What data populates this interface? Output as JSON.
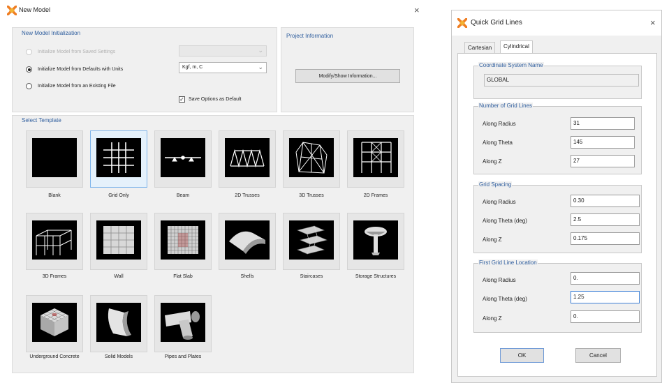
{
  "new_model": {
    "title": "New Model",
    "close_glyph": "×",
    "initialization": {
      "title": "New Model Initialization",
      "option_saved": "Initialize Model from Saved Settings",
      "option_defaults": "Initialize Model from Defaults with Units",
      "option_existing": "Initialize Model from an Existing File",
      "units_value": "Kgf, m, C",
      "save_default_label": "Save Options as Default",
      "save_default_check": "✓"
    },
    "project_information": {
      "title": "Project Information",
      "button_label": "Modify/Show Information..."
    },
    "templates": {
      "title": "Select Template",
      "items": [
        {
          "label": "Blank",
          "icon": "blank-template-icon"
        },
        {
          "label": "Grid Only",
          "icon": "grid-only-template-icon"
        },
        {
          "label": "Beam",
          "icon": "beam-template-icon"
        },
        {
          "label": "2D Trusses",
          "icon": "2d-trusses-template-icon"
        },
        {
          "label": "3D Trusses",
          "icon": "3d-trusses-template-icon"
        },
        {
          "label": "2D Frames",
          "icon": "2d-frames-template-icon"
        },
        {
          "label": "3D Frames",
          "icon": "3d-frames-template-icon"
        },
        {
          "label": "Wall",
          "icon": "wall-template-icon"
        },
        {
          "label": "Flat Slab",
          "icon": "flat-slab-template-icon"
        },
        {
          "label": "Shells",
          "icon": "shells-template-icon"
        },
        {
          "label": "Staircases",
          "icon": "staircases-template-icon"
        },
        {
          "label": "Storage Structures",
          "icon": "storage-structures-template-icon"
        },
        {
          "label": "Underground Concrete",
          "icon": "underground-concrete-template-icon"
        },
        {
          "label": "Solid Models",
          "icon": "solid-models-template-icon"
        },
        {
          "label": "Pipes and Plates",
          "icon": "pipes-and-plates-template-icon"
        }
      ]
    }
  },
  "quick_grid": {
    "title": "Quick Grid Lines",
    "close_glyph": "×",
    "tabs": [
      "Cartesian",
      "Cylindrical"
    ],
    "coord_system": {
      "title": "Coordinate System Name",
      "value": "GLOBAL"
    },
    "number_of_grid_lines": {
      "title": "Number of Grid Lines",
      "rows": [
        {
          "label": "Along  Radius",
          "value": "31"
        },
        {
          "label": "Along Theta",
          "value": "145"
        },
        {
          "label": "Along  Z",
          "value": "27"
        }
      ]
    },
    "grid_spacing": {
      "title": "Grid Spacing",
      "rows": [
        {
          "label": "Along Radius",
          "value": "0.30"
        },
        {
          "label": "Along Theta (deg)",
          "value": "2.5"
        },
        {
          "label": "Along  Z",
          "value": "0.175"
        }
      ]
    },
    "first_grid_line_location": {
      "title": "First Grid Line Location",
      "rows": [
        {
          "label": "Along Radius",
          "value": "0."
        },
        {
          "label": "Along Theta (deg)",
          "value": "1.25"
        },
        {
          "label": "Along  Z",
          "value": "0."
        }
      ]
    },
    "ok_label": "OK",
    "cancel_label": "Cancel"
  },
  "colors": {
    "group_title": "#2f5e9e",
    "app_icon_orange": "#ef7d22",
    "selected_tile": "#e5f1fb"
  }
}
